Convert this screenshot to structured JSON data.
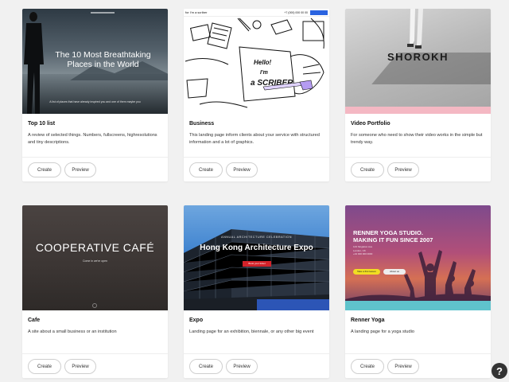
{
  "cards": [
    {
      "title": "Top 10 list",
      "description": "A review of selected things. Numbers, fullscreens, highresolutions and tiny descriptions.",
      "create_label": "Create",
      "preview_label": "Preview",
      "thumb": {
        "headline": "The 10 Most Breathtaking Places in the World",
        "caption": "A list of places that have already inspired you and one of them maybe you"
      }
    },
    {
      "title": "Business",
      "description": "This landing page inform clients about your service with structured information and a lot of graphics.",
      "create_label": "Create",
      "preview_label": "Preview",
      "thumb": {
        "brand": "for I'm a scriber",
        "phone": "+7 (000) 000 00 00",
        "sign_lines": [
          "Hello!",
          "I'm",
          "a SCRIBER"
        ]
      }
    },
    {
      "title": "Video Portfolio",
      "description": "For someone who need to show their video works in the simple but trendy way.",
      "create_label": "Create",
      "preview_label": "Preview",
      "thumb": {
        "headline": "SHOROKH"
      }
    },
    {
      "title": "Cafe",
      "description": "A site about a small business or an institution",
      "create_label": "Create",
      "preview_label": "Preview",
      "thumb": {
        "headline": "COOPERATIVE CAFÉ",
        "subline": "Come in we're open"
      }
    },
    {
      "title": "Expo",
      "description": "Landing page for an exhibition, biennale, or any other big event",
      "create_label": "Create",
      "preview_label": "Preview",
      "thumb": {
        "label": "ANNUAL ARCHITECTURE CELEBRATION",
        "headline": "Hong Kong Architecture Expo",
        "button": "Book your ticket"
      }
    },
    {
      "title": "Renner Yoga",
      "description": "A landing page for a yoga studio",
      "create_label": "Create",
      "preview_label": "Preview",
      "thumb": {
        "headline_line1": "RENNER YOGA STUDIO.",
        "headline_line2": "MAKING IT FUN SINCE 2007",
        "address_line1": "123 Singleton Ave",
        "address_line2": "London, UK",
        "address_line3": "+44 000 000 0000",
        "button1": "Take a first lesson",
        "button2": "About us"
      }
    }
  ],
  "help_label": "?",
  "colors": {
    "page_background": "#f1f1f1",
    "expo_accent": "#d3222a",
    "yoga_accent": "#f1de23",
    "video_pink": "#f4b8c3",
    "yoga_teal": "#5fc3cc"
  }
}
